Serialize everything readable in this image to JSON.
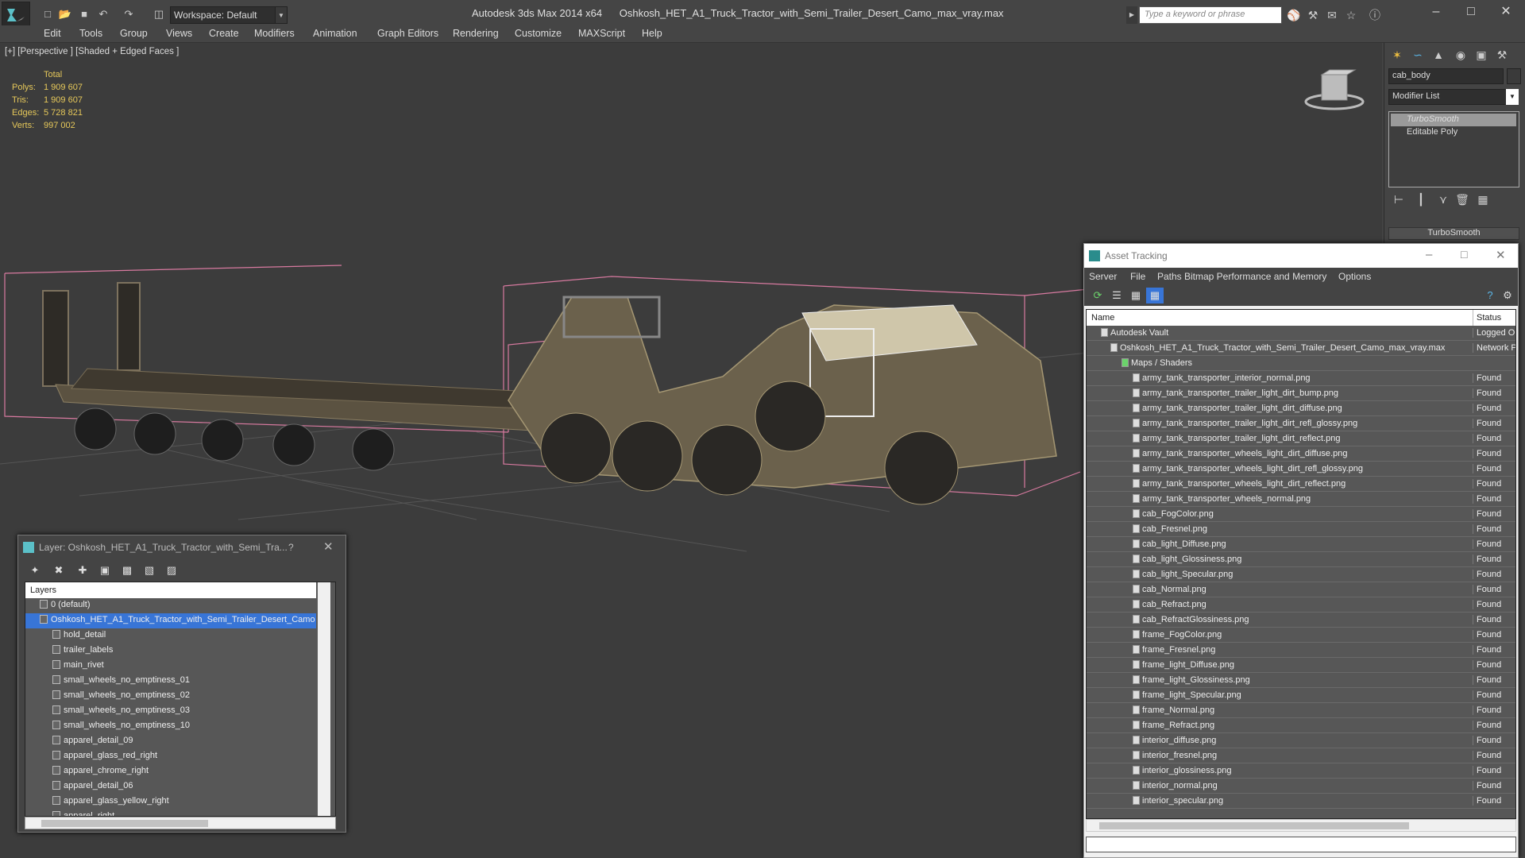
{
  "window": {
    "app_name": "Autodesk 3ds Max  2014 x64",
    "file_name": "Oshkosh_HET_A1_Truck_Tractor_with_Semi_Trailer_Desert_Camo_max_vray.max",
    "workspace": "Workspace: Default",
    "search_placeholder": "Type a keyword or phrase"
  },
  "menu": [
    "Edit",
    "Tools",
    "Group",
    "Views",
    "Create",
    "Modifiers",
    "Animation",
    "Graph Editors",
    "Rendering",
    "Customize",
    "MAXScript",
    "Help"
  ],
  "viewport": {
    "label": "[+] [Perspective ] [Shaded + Edged Faces ]",
    "stats_header": "Total",
    "stats": [
      {
        "label": "Polys:",
        "value": "1 909 607"
      },
      {
        "label": "Tris:",
        "value": "1 909 607"
      },
      {
        "label": "Edges:",
        "value": "5 728 821"
      },
      {
        "label": "Verts:",
        "value": "997 002"
      }
    ]
  },
  "command_panel": {
    "object_name": "cab_body",
    "modifier_list": "Modifier List",
    "stack": [
      "TurboSmooth",
      "Editable Poly"
    ],
    "rollout": "TurboSmooth"
  },
  "layer_window": {
    "title": "Layer: Oshkosh_HET_A1_Truck_Tractor_with_Semi_Tra...",
    "help": "?",
    "header": "Layers",
    "rows": [
      {
        "label": "0 (default)",
        "indent": 1,
        "selected": false
      },
      {
        "label": "Oshkosh_HET_A1_Truck_Tractor_with_Semi_Trailer_Desert_Camo",
        "indent": 1,
        "selected": true
      },
      {
        "label": "hold_detail",
        "indent": 2,
        "selected": false
      },
      {
        "label": "trailer_labels",
        "indent": 2,
        "selected": false
      },
      {
        "label": "main_rivet",
        "indent": 2,
        "selected": false
      },
      {
        "label": "small_wheels_no_emptiness_01",
        "indent": 2,
        "selected": false
      },
      {
        "label": "small_wheels_no_emptiness_02",
        "indent": 2,
        "selected": false
      },
      {
        "label": "small_wheels_no_emptiness_03",
        "indent": 2,
        "selected": false
      },
      {
        "label": "small_wheels_no_emptiness_10",
        "indent": 2,
        "selected": false
      },
      {
        "label": "apparel_detail_09",
        "indent": 2,
        "selected": false
      },
      {
        "label": "apparel_glass_red_right",
        "indent": 2,
        "selected": false
      },
      {
        "label": "apparel_chrome_right",
        "indent": 2,
        "selected": false
      },
      {
        "label": "apparel_detail_06",
        "indent": 2,
        "selected": false
      },
      {
        "label": "apparel_glass_yellow_right",
        "indent": 2,
        "selected": false
      },
      {
        "label": "apparel_right",
        "indent": 2,
        "selected": false
      }
    ]
  },
  "asset_window": {
    "title": "Asset Tracking",
    "menu": [
      "Server",
      "File",
      "Paths",
      "Bitmap Performance and Memory",
      "Options"
    ],
    "col_name": "Name",
    "col_status": "Status",
    "rows": [
      {
        "name": "Autodesk Vault",
        "status": "Logged Out",
        "level": 1
      },
      {
        "name": "Oshkosh_HET_A1_Truck_Tractor_with_Semi_Trailer_Desert_Camo_max_vray.max",
        "status": "Network Path",
        "level": 2
      },
      {
        "name": "Maps / Shaders",
        "status": "",
        "level": 3
      },
      {
        "name": "army_tank_transporter_interior_normal.png",
        "status": "Found",
        "level": 4
      },
      {
        "name": "army_tank_transporter_trailer_light_dirt_bump.png",
        "status": "Found",
        "level": 4
      },
      {
        "name": "army_tank_transporter_trailer_light_dirt_diffuse.png",
        "status": "Found",
        "level": 4
      },
      {
        "name": "army_tank_transporter_trailer_light_dirt_refl_glossy.png",
        "status": "Found",
        "level": 4
      },
      {
        "name": "army_tank_transporter_trailer_light_dirt_reflect.png",
        "status": "Found",
        "level": 4
      },
      {
        "name": "army_tank_transporter_wheels_light_dirt_diffuse.png",
        "status": "Found",
        "level": 4
      },
      {
        "name": "army_tank_transporter_wheels_light_dirt_refl_glossy.png",
        "status": "Found",
        "level": 4
      },
      {
        "name": "army_tank_transporter_wheels_light_dirt_reflect.png",
        "status": "Found",
        "level": 4
      },
      {
        "name": "army_tank_transporter_wheels_normal.png",
        "status": "Found",
        "level": 4
      },
      {
        "name": "cab_FogColor.png",
        "status": "Found",
        "level": 4
      },
      {
        "name": "cab_Fresnel.png",
        "status": "Found",
        "level": 4
      },
      {
        "name": "cab_light_Diffuse.png",
        "status": "Found",
        "level": 4
      },
      {
        "name": "cab_light_Glossiness.png",
        "status": "Found",
        "level": 4
      },
      {
        "name": "cab_light_Specular.png",
        "status": "Found",
        "level": 4
      },
      {
        "name": "cab_Normal.png",
        "status": "Found",
        "level": 4
      },
      {
        "name": "cab_Refract.png",
        "status": "Found",
        "level": 4
      },
      {
        "name": "cab_RefractGlossiness.png",
        "status": "Found",
        "level": 4
      },
      {
        "name": "frame_FogColor.png",
        "status": "Found",
        "level": 4
      },
      {
        "name": "frame_Fresnel.png",
        "status": "Found",
        "level": 4
      },
      {
        "name": "frame_light_Diffuse.png",
        "status": "Found",
        "level": 4
      },
      {
        "name": "frame_light_Glossiness.png",
        "status": "Found",
        "level": 4
      },
      {
        "name": "frame_light_Specular.png",
        "status": "Found",
        "level": 4
      },
      {
        "name": "frame_Normal.png",
        "status": "Found",
        "level": 4
      },
      {
        "name": "frame_Refract.png",
        "status": "Found",
        "level": 4
      },
      {
        "name": "interior_diffuse.png",
        "status": "Found",
        "level": 4
      },
      {
        "name": "interior_fresnel.png",
        "status": "Found",
        "level": 4
      },
      {
        "name": "interior_glossiness.png",
        "status": "Found",
        "level": 4
      },
      {
        "name": "interior_normal.png",
        "status": "Found",
        "level": 4
      },
      {
        "name": "interior_specular.png",
        "status": "Found",
        "level": 4
      }
    ]
  },
  "colors": {
    "ui_dark": "#444444",
    "stats_yellow": "#e6c85a",
    "selection_blue": "#3875d7",
    "bbox_pink": "#d87aa0"
  }
}
